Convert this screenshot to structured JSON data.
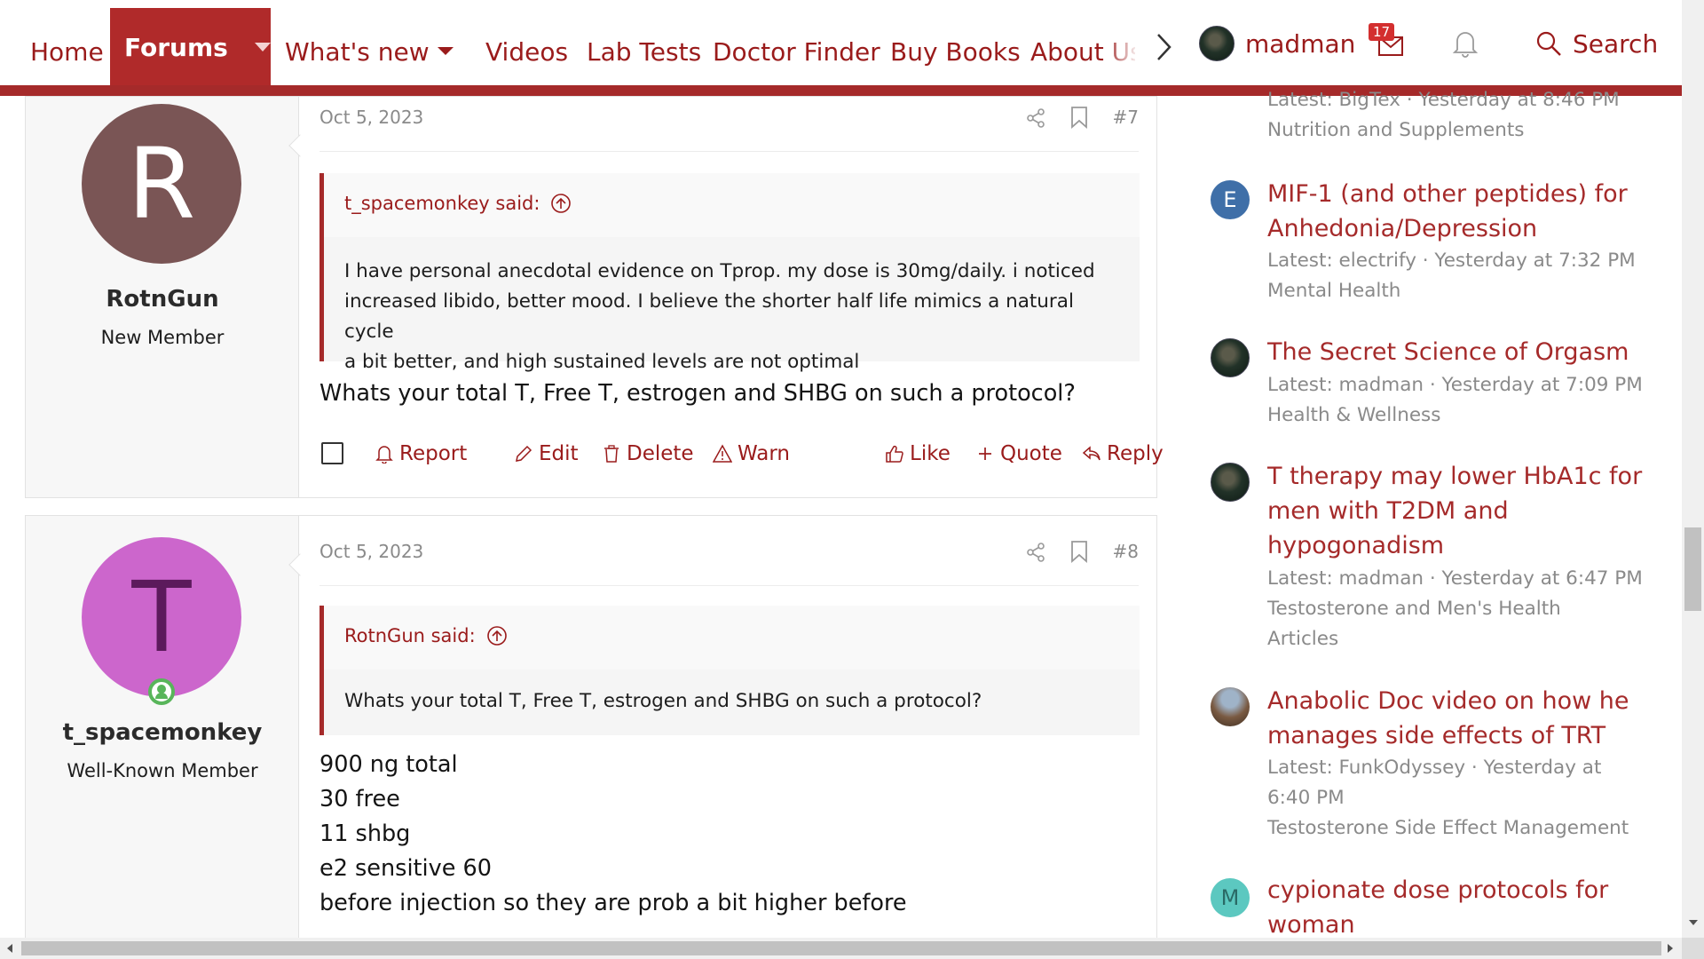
{
  "nav": {
    "home": "Home",
    "forums": "Forums",
    "whats_new": "What's new",
    "videos": "Videos",
    "lab_tests": "Lab Tests",
    "doctor_finder": "Doctor Finder",
    "buy_books": "Buy Books",
    "about_us": "About Us",
    "username": "madman",
    "inbox_count": "17",
    "search": "Search"
  },
  "posts": [
    {
      "date": "Oct 5, 2023",
      "number": "#7",
      "user": {
        "initial": "R",
        "name": "RotnGun",
        "title": "New Member",
        "avatar_bg": "#7a5555",
        "avatar_fg": "#ffffff"
      },
      "quote": {
        "author": "t_spacemonkey said:",
        "lines": [
          "I have personal anecdotal evidence on Tprop. my dose is 30mg/daily. i noticed",
          "increased libido, better mood. I believe the shorter half life mimics a natural cycle",
          "a bit better, and high sustained levels are not optimal"
        ]
      },
      "body": [
        "Whats your total T, Free T, estrogen and SHBG on such a protocol?"
      ],
      "actions": {
        "report": "Report",
        "edit": "Edit",
        "delete": "Delete",
        "warn": "Warn",
        "like": "Like",
        "quote": "Quote",
        "reply": "Reply"
      }
    },
    {
      "date": "Oct 5, 2023",
      "number": "#8",
      "user": {
        "initial": "T",
        "name": "t_spacemonkey",
        "title": "Well-Known Member",
        "avatar_bg": "#cc66cc",
        "avatar_fg": "#5c1a5c"
      },
      "quote": {
        "author": "RotnGun said:",
        "lines": [
          "Whats your total T, Free T, estrogen and SHBG on such a protocol?"
        ]
      },
      "body": [
        "900 ng total",
        "30 free",
        "11 shbg",
        "e2 sensitive 60",
        "before injection so they are prob a bit higher before"
      ]
    }
  ],
  "sidebar": {
    "partial_top": {
      "latest": "Latest: BigTex · Yesterday at 8:46 PM",
      "forum": "Nutrition and Supplements"
    },
    "items": [
      {
        "avatar": "E",
        "avatar_color": "#3f6fa8",
        "title_lines": [
          "MIF-1 (and other peptides) for",
          "Anhedonia/Depression"
        ],
        "meta_lines": [
          "Latest: electrify · Yesterday at 7:32 PM",
          "Mental Health"
        ]
      },
      {
        "avatar": "",
        "avatar_color": "#1c2a22",
        "title_lines": [
          "The Secret Science of Orgasm"
        ],
        "meta_lines": [
          "Latest: madman · Yesterday at 7:09 PM",
          "Health & Wellness"
        ]
      },
      {
        "avatar": "",
        "avatar_color": "#1c2a22",
        "title_lines": [
          "T therapy may lower HbA1c for",
          "men with T2DM and",
          "hypogonadism"
        ],
        "meta_lines": [
          "Latest: madman · Yesterday at 6:47 PM",
          "Testosterone and Men's Health",
          "Articles"
        ]
      },
      {
        "avatar": "",
        "avatar_color": "#6b5a4a",
        "title_lines": [
          "Anabolic Doc video on how he",
          "manages side effects of TRT"
        ],
        "meta_lines": [
          "Latest: FunkOdyssey · Yesterday at",
          "6:40 PM",
          "Testosterone Side Effect Management"
        ]
      },
      {
        "avatar": "M",
        "avatar_color": "#5cc8c0",
        "title_lines": [
          "cypionate dose protocols for",
          "woman"
        ],
        "meta_lines": []
      }
    ]
  }
}
